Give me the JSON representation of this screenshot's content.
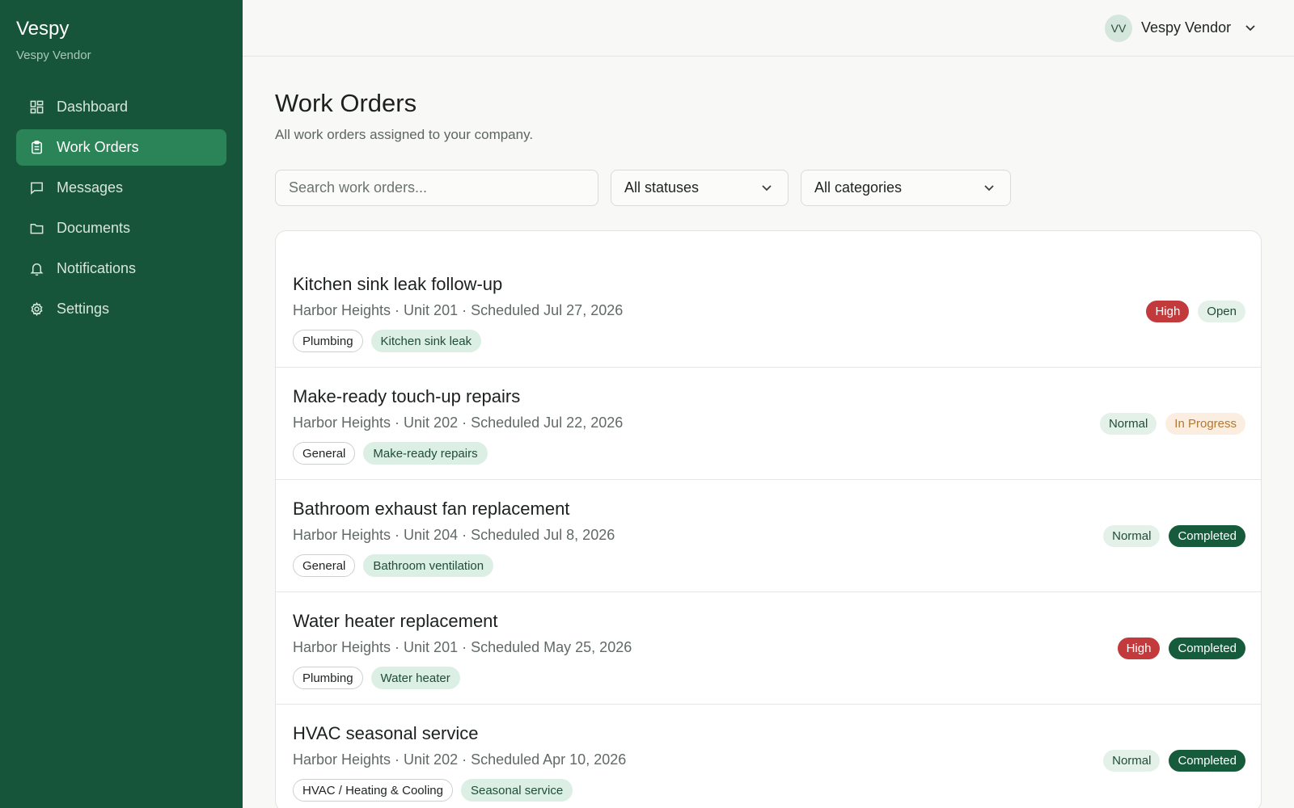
{
  "app": {
    "name": "Vespy",
    "account": "Vespy Vendor"
  },
  "sidebar": {
    "items": [
      {
        "label": "Dashboard",
        "icon": "dashboard-icon",
        "active": false
      },
      {
        "label": "Work Orders",
        "icon": "clipboard-icon",
        "active": true
      },
      {
        "label": "Messages",
        "icon": "message-icon",
        "active": false
      },
      {
        "label": "Documents",
        "icon": "folder-icon",
        "active": false
      },
      {
        "label": "Notifications",
        "icon": "bell-icon",
        "active": false
      },
      {
        "label": "Settings",
        "icon": "gear-icon",
        "active": false
      }
    ]
  },
  "topbar": {
    "avatar_initials": "VV",
    "user_name": "Vespy Vendor"
  },
  "page": {
    "title": "Work Orders",
    "subtitle": "All work orders assigned to your company."
  },
  "filters": {
    "search_placeholder": "Search work orders...",
    "status_value": "All statuses",
    "category_value": "All categories"
  },
  "work_orders": [
    {
      "title": "Kitchen sink leak follow-up",
      "meta": "Harbor Heights · Unit 201 · Scheduled Jul 27, 2026",
      "category": "Plumbing",
      "subcategory": "Kitchen sink leak",
      "priority": "High",
      "status": "Open"
    },
    {
      "title": "Make-ready touch-up repairs",
      "meta": "Harbor Heights · Unit 202 · Scheduled Jul 22, 2026",
      "category": "General",
      "subcategory": "Make-ready repairs",
      "priority": "Normal",
      "status": "In Progress"
    },
    {
      "title": "Bathroom exhaust fan replacement",
      "meta": "Harbor Heights · Unit 204 · Scheduled Jul 8, 2026",
      "category": "General",
      "subcategory": "Bathroom ventilation",
      "priority": "Normal",
      "status": "Completed"
    },
    {
      "title": "Water heater replacement",
      "meta": "Harbor Heights · Unit 201 · Scheduled May 25, 2026",
      "category": "Plumbing",
      "subcategory": "Water heater",
      "priority": "High",
      "status": "Completed"
    },
    {
      "title": "HVAC seasonal service",
      "meta": "Harbor Heights · Unit 202 · Scheduled Apr 10, 2026",
      "category": "HVAC / Heating & Cooling",
      "subcategory": "Seasonal service",
      "priority": "Normal",
      "status": "Completed"
    }
  ],
  "colors": {
    "sidebar_bg": "#17553a",
    "active_nav": "#2b8358",
    "high": "#c23a3c",
    "completed": "#165c3c",
    "in_progress_text": "#b3772f"
  }
}
